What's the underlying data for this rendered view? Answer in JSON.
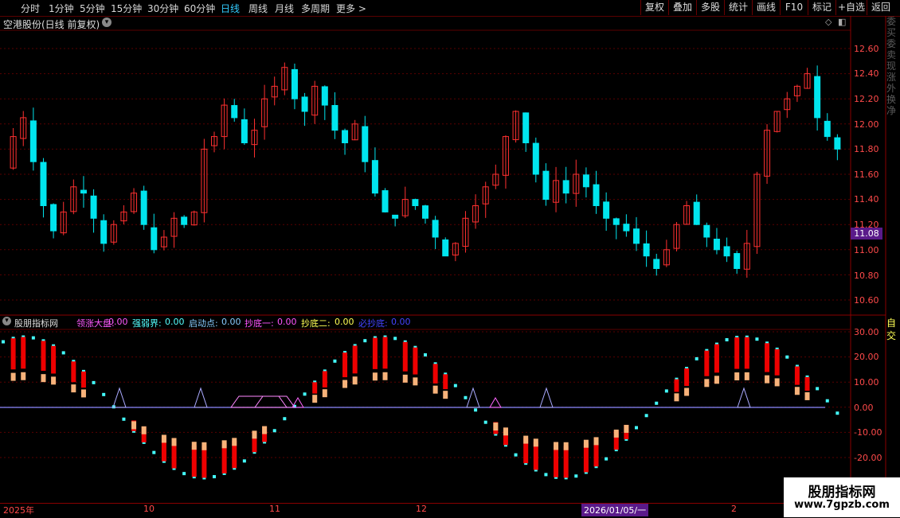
{
  "periods": [
    "分时",
    "1分钟",
    "5分钟",
    "15分钟",
    "30分钟",
    "60分钟",
    "日线",
    "周线",
    "月线",
    "多周期",
    "更多 >"
  ],
  "active_period": "日线",
  "toolbar_buttons": [
    "复权",
    "叠加",
    "多股",
    "统计",
    "画线",
    "F10",
    "标记",
    "+自选",
    "返回"
  ],
  "stock_title": "空港股份(日线 前复权)",
  "price_axis": [
    "12.60",
    "12.40",
    "12.20",
    "12.00",
    "11.80",
    "11.60",
    "11.40",
    "11.20",
    "11.00",
    "10.80",
    "10.60"
  ],
  "current_price": "11.08",
  "indicator": {
    "name": "股朋指标网",
    "items": [
      {
        "label": "领涨大盘:",
        "value": "0.00",
        "color": "#ff5aff"
      },
      {
        "label": "强弱界:",
        "value": "0.00",
        "color": "#5ff"
      },
      {
        "label": "启动点:",
        "value": "0.00",
        "color": "#8cf"
      },
      {
        "label": "抄底一:",
        "value": "0.00",
        "color": "#f5f"
      },
      {
        "label": "抄底二:",
        "value": "0.00",
        "color": "#ff5"
      },
      {
        "label": "必抄底:",
        "value": "0.00",
        "color": "#44f"
      }
    ]
  },
  "indicator_axis": [
    "30.00",
    "20.00",
    "10.00",
    "0.00",
    "-10.00",
    "-20.00"
  ],
  "time_axis": [
    "2025年",
    "10",
    "11",
    "12",
    "2026/01/05/一",
    "2"
  ],
  "watermark": {
    "line1": "股朋指标网",
    "line2": "www.7gpzb.com"
  },
  "right_strip_text": "委买委卖现涨外换净",
  "right_strip_text2": "自交",
  "colors": {
    "up": "#ff3030",
    "down": "#00e5ee",
    "grid": "#5a0000",
    "baseline": "#8a8aff"
  }
}
